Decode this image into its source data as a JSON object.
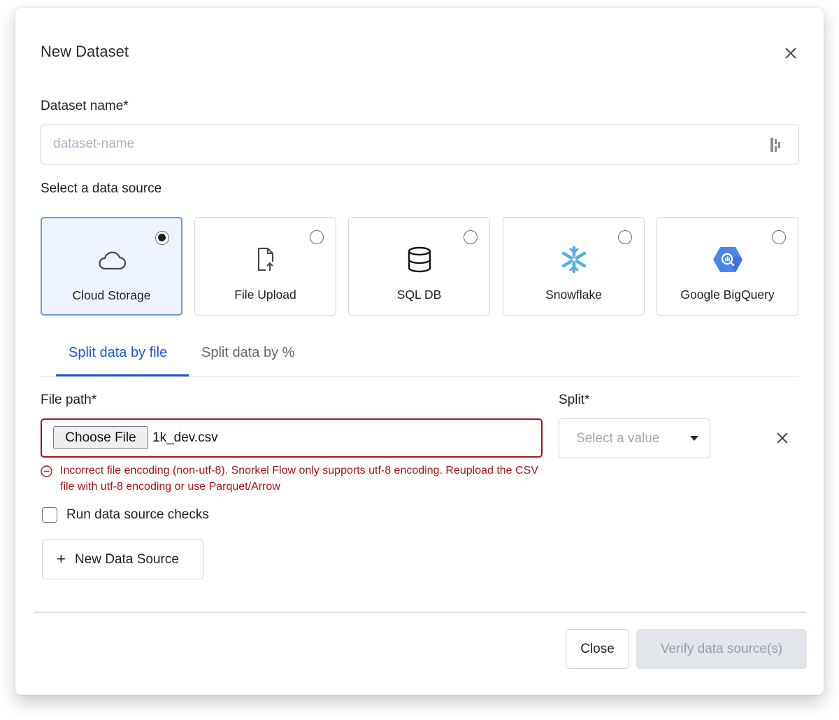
{
  "dialog": {
    "title": "New Dataset",
    "close_icon": "close-icon"
  },
  "dataset_name": {
    "label": "Dataset name*",
    "placeholder": "dataset-name",
    "value": "",
    "icon": "field-options-icon"
  },
  "data_source": {
    "label": "Select a data source",
    "selected": "Cloud Storage",
    "options": [
      {
        "label": "Cloud Storage",
        "icon": "cloud-icon",
        "selected": true
      },
      {
        "label": "File Upload",
        "icon": "file-upload-icon",
        "selected": false
      },
      {
        "label": "SQL DB",
        "icon": "database-icon",
        "selected": false
      },
      {
        "label": "Snowflake",
        "icon": "snowflake-icon",
        "selected": false
      },
      {
        "label": "Google BigQuery",
        "icon": "bigquery-icon",
        "selected": false
      }
    ]
  },
  "tabs": [
    {
      "label": "Split data by file",
      "active": true
    },
    {
      "label": "Split data by %",
      "active": false
    }
  ],
  "file_path": {
    "label": "File path*",
    "choose_button": "Choose File",
    "file_name": "1k_dev.csv",
    "error": "Incorrect file encoding (non-utf-8). Snorkel Flow only supports utf-8 encoding. Reupload the CSV file with utf-8 encoding or use Parquet/Arrow"
  },
  "split": {
    "label": "Split*",
    "placeholder": "Select a value"
  },
  "checks": {
    "label": "Run data source checks",
    "checked": false
  },
  "new_source_button": {
    "plus": "+",
    "label": "New Data Source"
  },
  "footer": {
    "close_label": "Close",
    "verify_label": "Verify data source(s)",
    "verify_disabled": true
  },
  "colors": {
    "accent": "#1a56db",
    "error": "#a4161a",
    "selected_card_bg": "#edf4ff",
    "selected_card_border": "#6b97e8",
    "disabled_button_bg": "#e2e5e9"
  }
}
